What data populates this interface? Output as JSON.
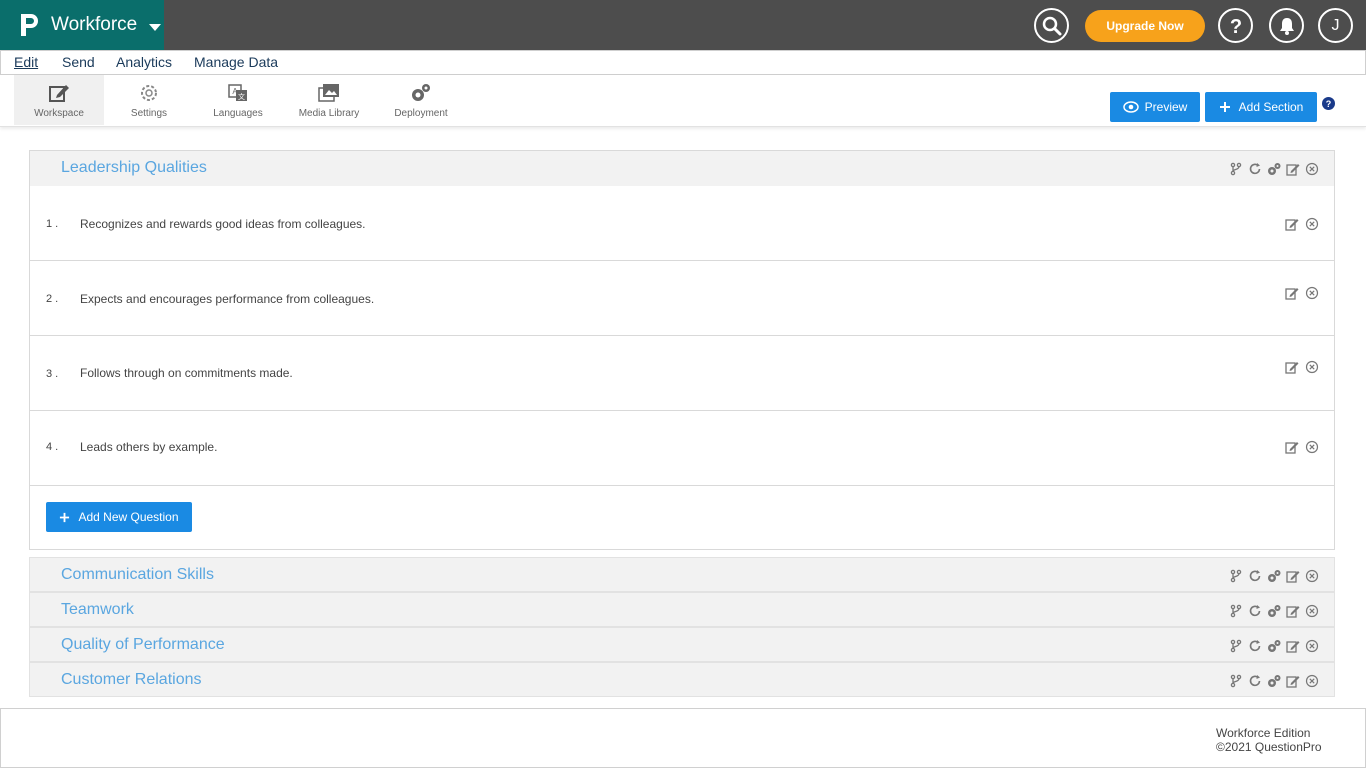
{
  "app": {
    "name": "Workforce"
  },
  "header": {
    "upgrade_label": "Upgrade Now",
    "user_initial": "J"
  },
  "menu": {
    "items": [
      {
        "label": "Edit"
      },
      {
        "label": "Send"
      },
      {
        "label": "Analytics"
      },
      {
        "label": "Manage Data"
      }
    ]
  },
  "toolbar": {
    "tools": [
      {
        "label": "Workspace"
      },
      {
        "label": "Settings"
      },
      {
        "label": "Languages"
      },
      {
        "label": "Media Library"
      },
      {
        "label": "Deployment"
      }
    ],
    "preview_label": "Preview",
    "add_section_label": "Add Section"
  },
  "sections": [
    {
      "title": "Leadership Qualities",
      "questions": [
        {
          "num": "1 .",
          "text": "Recognizes and rewards good ideas from colleagues."
        },
        {
          "num": "2 .",
          "text": "Expects and encourages performance from colleagues."
        },
        {
          "num": "3 .",
          "text": "Follows through on commitments made."
        },
        {
          "num": "4 .",
          "text": "Leads others by example."
        }
      ],
      "add_question_label": "Add New Question"
    },
    {
      "title": "Communication Skills"
    },
    {
      "title": "Teamwork"
    },
    {
      "title": "Quality of Performance"
    },
    {
      "title": "Customer Relations"
    }
  ],
  "footer": {
    "edition": "Workforce Edition",
    "copyright": "©2021 QuestionPro"
  },
  "colors": {
    "brand": "#0a6e6b",
    "topbar": "#4d4d4d",
    "accent": "#1a8ae3",
    "upgrade": "#f7a21b",
    "section_title": "#5aa6e0"
  }
}
